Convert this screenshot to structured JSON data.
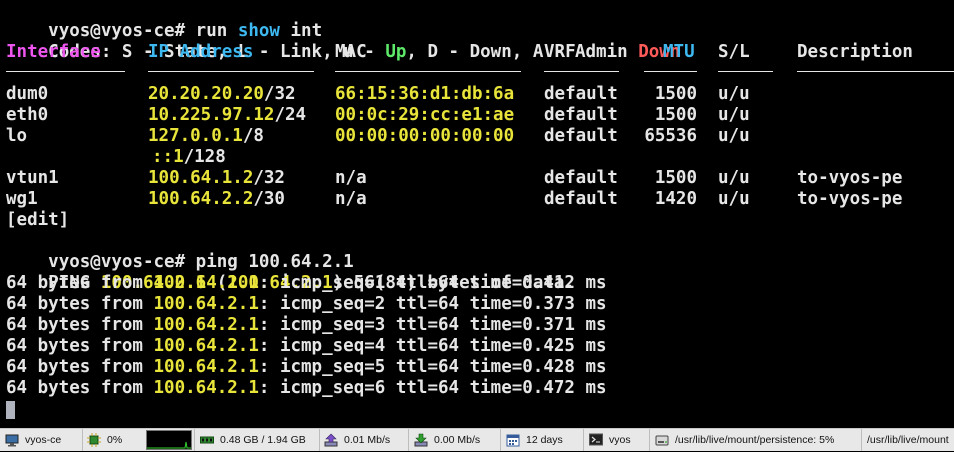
{
  "terminal": {
    "prompt1": "vyos@vyos-ce# ",
    "cmd1_run": "run ",
    "cmd1_show": "show",
    "cmd1_int": " int",
    "codes": {
      "part1": "Codes: S - State, L - Link, u - ",
      "up": "Up",
      "part2": ", D - Down, A - Admin ",
      "down": "Down"
    },
    "headers": {
      "interface": "Interface",
      "ip": "IP Address",
      "mac": "MAC",
      "vrf": "VRF",
      "mtu": "MTU",
      "sl": "S/L",
      "desc": "Description"
    },
    "rows": [
      {
        "iface": "dum0",
        "ip": "20.20.20.20",
        "cidr": "/32",
        "mac": "66:15:36:d1:db:6a",
        "vrf": "default",
        "mtu": "1500",
        "sl": "u/u",
        "desc": ""
      },
      {
        "iface": "eth0",
        "ip": "10.225.97.12",
        "cidr": "/24",
        "mac": "00:0c:29:cc:e1:ae",
        "vrf": "default",
        "mtu": "1500",
        "sl": "u/u",
        "desc": ""
      },
      {
        "iface": "lo",
        "ip": "127.0.0.1",
        "cidr": "/8",
        "mac": "00:00:00:00:00:00",
        "vrf": "default",
        "mtu": "65536",
        "sl": "u/u",
        "desc": ""
      },
      {
        "iface": "",
        "ip": "::1",
        "cidr": "/128",
        "mac": "",
        "vrf": "",
        "mtu": "",
        "sl": "",
        "desc": ""
      },
      {
        "iface": "vtun1",
        "ip": "100.64.1.2",
        "cidr": "/32",
        "mac": "n/a",
        "vrf": "default",
        "mtu": "1500",
        "sl": "u/u",
        "desc": "to-vyos-pe"
      },
      {
        "iface": "wg1",
        "ip": "100.64.2.2",
        "cidr": "/30",
        "mac": "n/a",
        "vrf": "default",
        "mtu": "1420",
        "sl": "u/u",
        "desc": "to-vyos-pe"
      }
    ],
    "edit": "[edit]",
    "prompt2": "vyos@vyos-ce# ",
    "cmd2": "ping 100.64.2.1",
    "ping_header": {
      "pre": "PING ",
      "ip": "100.64.2.1",
      "mid": " (",
      "ip2": "100.64.2.1",
      "post": ") 56(84) bytes of data."
    },
    "ping_lines": [
      {
        "pre": "64 bytes from ",
        "ip": "100.64.2.1",
        "rest": ": icmp_seq=1 ttl=64 time=0.412 ms"
      },
      {
        "pre": "64 bytes from ",
        "ip": "100.64.2.1",
        "rest": ": icmp_seq=2 ttl=64 time=0.373 ms"
      },
      {
        "pre": "64 bytes from ",
        "ip": "100.64.2.1",
        "rest": ": icmp_seq=3 ttl=64 time=0.371 ms"
      },
      {
        "pre": "64 bytes from ",
        "ip": "100.64.2.1",
        "rest": ": icmp_seq=4 ttl=64 time=0.425 ms"
      },
      {
        "pre": "64 bytes from ",
        "ip": "100.64.2.1",
        "rest": ": icmp_seq=5 ttl=64 time=0.428 ms"
      },
      {
        "pre": "64 bytes from ",
        "ip": "100.64.2.1",
        "rest": ": icmp_seq=6 ttl=64 time=0.472 ms"
      }
    ]
  },
  "taskbar": {
    "host": "vyos-ce",
    "cpu": "0%",
    "memory": "0.48 GB / 1.94 GB",
    "upload": "0.01 Mb/s",
    "download": "0.00 Mb/s",
    "uptime": "12 days",
    "user": "vyos",
    "disk1": "/usr/lib/live/mount/persistence: 5%",
    "disk2": "/usr/lib/live/mount",
    "icons": [
      "monitor-icon",
      "chip-icon",
      "memory-icon",
      "upload-icon",
      "download-icon",
      "calendar-icon",
      "terminal-user-icon",
      "disk-icon"
    ]
  }
}
